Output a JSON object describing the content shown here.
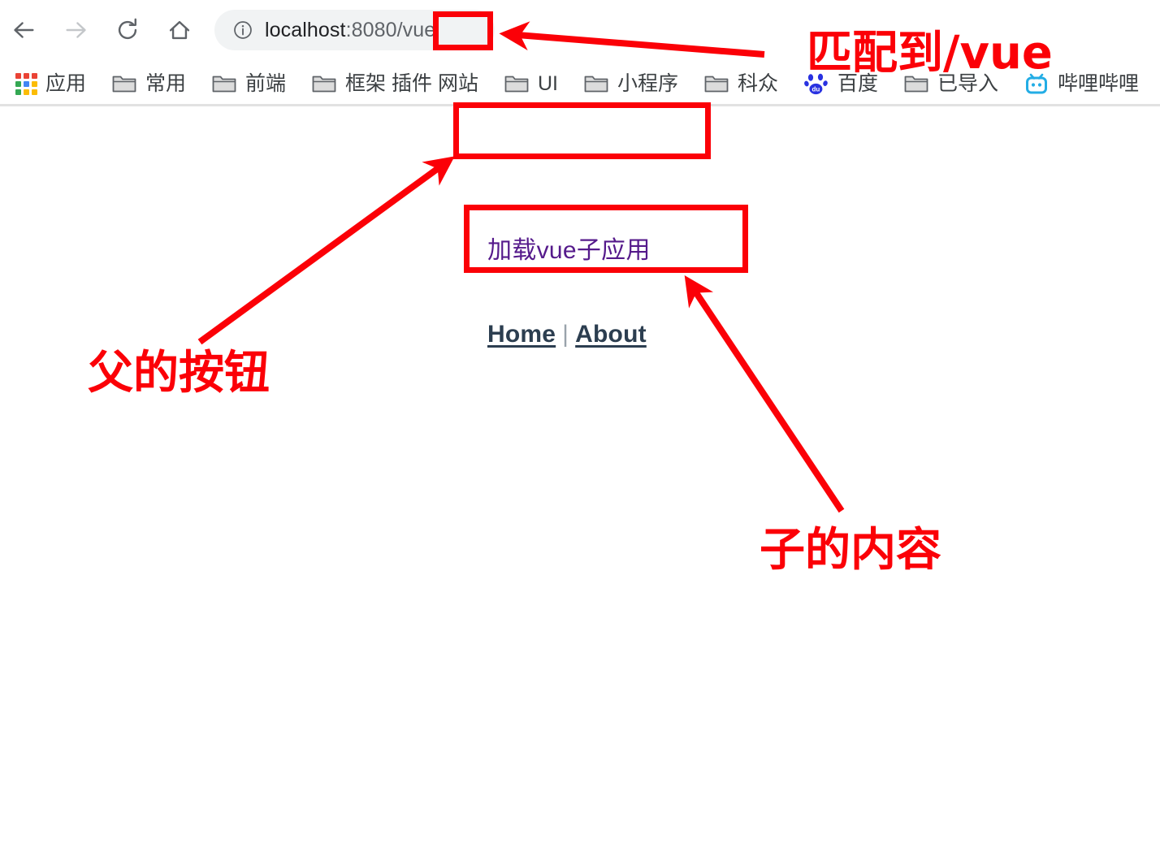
{
  "browser": {
    "nav": [
      {
        "name": "back",
        "icon": "arrow-left-icon",
        "state": "enabled"
      },
      {
        "name": "forward",
        "icon": "arrow-right-icon",
        "state": "disabled"
      },
      {
        "name": "reload",
        "icon": "reload-icon",
        "state": "enabled"
      },
      {
        "name": "home",
        "icon": "home-icon",
        "state": "enabled"
      }
    ],
    "omnibox": {
      "site_info_icon": "info-circle-icon",
      "url_host": "localhost",
      "url_rest": ":8080/vue",
      "url_full": "localhost:8080/vue"
    },
    "bookmarks": [
      {
        "label": "应用",
        "icon": "apps-grid-icon"
      },
      {
        "label": "常用",
        "icon": "folder-icon"
      },
      {
        "label": "前端",
        "icon": "folder-icon"
      },
      {
        "label": "框架 插件 网站",
        "icon": "folder-icon"
      },
      {
        "label": "UI",
        "icon": "folder-icon"
      },
      {
        "label": "小程序",
        "icon": "folder-icon"
      },
      {
        "label": "科众",
        "icon": "folder-icon"
      },
      {
        "label": "百度",
        "icon": "baidu-paw-icon"
      },
      {
        "label": "已导入",
        "icon": "folder-icon"
      },
      {
        "label": "哔哩哔哩",
        "icon": "bilibili-tv-icon"
      }
    ]
  },
  "page": {
    "parent_button_label": "加载vue子应用",
    "child_nav": {
      "home_label": "Home",
      "separator": "|",
      "about_label": "About"
    }
  },
  "annotations": {
    "url_note": "匹配到/vue",
    "parent_note": "父的按钮",
    "child_note": "子的内容",
    "color": "#fb0007"
  },
  "colors": {
    "omnibox_bg": "#f1f3f4",
    "url_host": "#202124",
    "url_rest": "#5f6368",
    "visited_link": "#551a8b",
    "child_nav_text": "#2c3e50",
    "annotation_red": "#fb0007",
    "bookmark_label": "#3c4043",
    "chrome_divider": "#e2e2e2"
  }
}
